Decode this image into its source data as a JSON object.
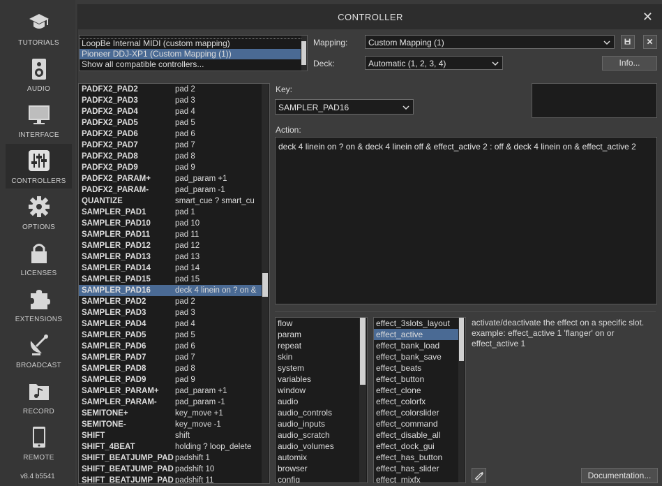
{
  "sidebar": {
    "items": [
      {
        "label": "TUTORIALS",
        "icon": "graduation-cap-icon"
      },
      {
        "label": "AUDIO",
        "icon": "speaker-icon"
      },
      {
        "label": "INTERFACE",
        "icon": "monitor-icon"
      },
      {
        "label": "CONTROLLERS",
        "icon": "sliders-icon"
      },
      {
        "label": "OPTIONS",
        "icon": "gear-icon"
      },
      {
        "label": "LICENSES",
        "icon": "lock-icon"
      },
      {
        "label": "EXTENSIONS",
        "icon": "puzzle-icon"
      },
      {
        "label": "BROADCAST",
        "icon": "satellite-dish-icon"
      },
      {
        "label": "RECORD",
        "icon": "music-folder-icon"
      },
      {
        "label": "REMOTE",
        "icon": "phone-icon"
      }
    ],
    "active": "CONTROLLERS",
    "version": "v8.4 b5541"
  },
  "window": {
    "title": "CONTROLLER",
    "close": "✕"
  },
  "devices": {
    "items": [
      "LoopBe Internal MIDI (custom mapping)",
      "Pioneer DDJ-XP1 (Custom Mapping (1))",
      "Show all compatible controllers..."
    ],
    "selected_index": 1
  },
  "mapping": {
    "label": "Mapping:",
    "value": "Custom Mapping (1)"
  },
  "deck": {
    "label": "Deck:",
    "value": "Automatic (1, 2, 3, 4)"
  },
  "info_button": "Info...",
  "key": {
    "label": "Key:",
    "value": "SAMPLER_PAD16"
  },
  "action": {
    "label": "Action:",
    "value": "deck 4 linein on ? on & deck 4 linein off & effect_active 2 : off & deck 4 linein on & effect_active 2"
  },
  "mappings": [
    {
      "key": "PADFX2_PAD2",
      "action": "pad 2"
    },
    {
      "key": "PADFX2_PAD3",
      "action": "pad 3"
    },
    {
      "key": "PADFX2_PAD4",
      "action": "pad 4"
    },
    {
      "key": "PADFX2_PAD5",
      "action": "pad 5"
    },
    {
      "key": "PADFX2_PAD6",
      "action": "pad 6"
    },
    {
      "key": "PADFX2_PAD7",
      "action": "pad 7"
    },
    {
      "key": "PADFX2_PAD8",
      "action": "pad 8"
    },
    {
      "key": "PADFX2_PAD9",
      "action": "pad 9"
    },
    {
      "key": "PADFX2_PARAM+",
      "action": "pad_param +1"
    },
    {
      "key": "PADFX2_PARAM-",
      "action": "pad_param -1"
    },
    {
      "key": "QUANTIZE",
      "action": "smart_cue ? smart_cu"
    },
    {
      "key": "SAMPLER_PAD1",
      "action": "pad 1"
    },
    {
      "key": "SAMPLER_PAD10",
      "action": "pad 10"
    },
    {
      "key": "SAMPLER_PAD11",
      "action": "pad 11"
    },
    {
      "key": "SAMPLER_PAD12",
      "action": "pad 12"
    },
    {
      "key": "SAMPLER_PAD13",
      "action": "pad 13"
    },
    {
      "key": "SAMPLER_PAD14",
      "action": "pad 14"
    },
    {
      "key": "SAMPLER_PAD15",
      "action": "pad 15"
    },
    {
      "key": "SAMPLER_PAD16",
      "action": "deck 4 linein on ? on &"
    },
    {
      "key": "SAMPLER_PAD2",
      "action": "pad 2"
    },
    {
      "key": "SAMPLER_PAD3",
      "action": "pad 3"
    },
    {
      "key": "SAMPLER_PAD4",
      "action": "pad 4"
    },
    {
      "key": "SAMPLER_PAD5",
      "action": "pad 5"
    },
    {
      "key": "SAMPLER_PAD6",
      "action": "pad 6"
    },
    {
      "key": "SAMPLER_PAD7",
      "action": "pad 7"
    },
    {
      "key": "SAMPLER_PAD8",
      "action": "pad 8"
    },
    {
      "key": "SAMPLER_PAD9",
      "action": "pad 9"
    },
    {
      "key": "SAMPLER_PARAM+",
      "action": "pad_param +1"
    },
    {
      "key": "SAMPLER_PARAM-",
      "action": "pad_param -1"
    },
    {
      "key": "SEMITONE+",
      "action": "key_move +1"
    },
    {
      "key": "SEMITONE-",
      "action": "key_move -1"
    },
    {
      "key": "SHIFT",
      "action": "shift"
    },
    {
      "key": "SHIFT_4BEAT",
      "action": "holding ? loop_delete"
    },
    {
      "key": "SHIFT_BEATJUMP_PAD",
      "action": "padshift 1"
    },
    {
      "key": "SHIFT_BEATJUMP_PAD",
      "action": "padshift 10"
    },
    {
      "key": "SHIFT_BEATJUMP_PAD",
      "action": "padshift 11"
    }
  ],
  "mappings_selected": 18,
  "categories": [
    "flow",
    "param",
    "repeat",
    "skin",
    "system",
    "variables",
    "window",
    "audio",
    "audio_controls",
    "audio_inputs",
    "audio_scratch",
    "audio_volumes",
    "automix",
    "browser",
    "config"
  ],
  "verbs": [
    "effect_3slots_layout",
    "effect_active",
    "effect_bank_load",
    "effect_bank_save",
    "effect_beats",
    "effect_button",
    "effect_clone",
    "effect_colorfx",
    "effect_colorslider",
    "effect_command",
    "effect_disable_all",
    "effect_dock_gui",
    "effect_has_button",
    "effect_has_slider",
    "effect_mixfx"
  ],
  "verbs_selected": 1,
  "description": "activate/deactivate the effect on a specific slot.\nexample: effect_active 1 'flanger' on or effect_active 1",
  "doc_button": "Documentation..."
}
